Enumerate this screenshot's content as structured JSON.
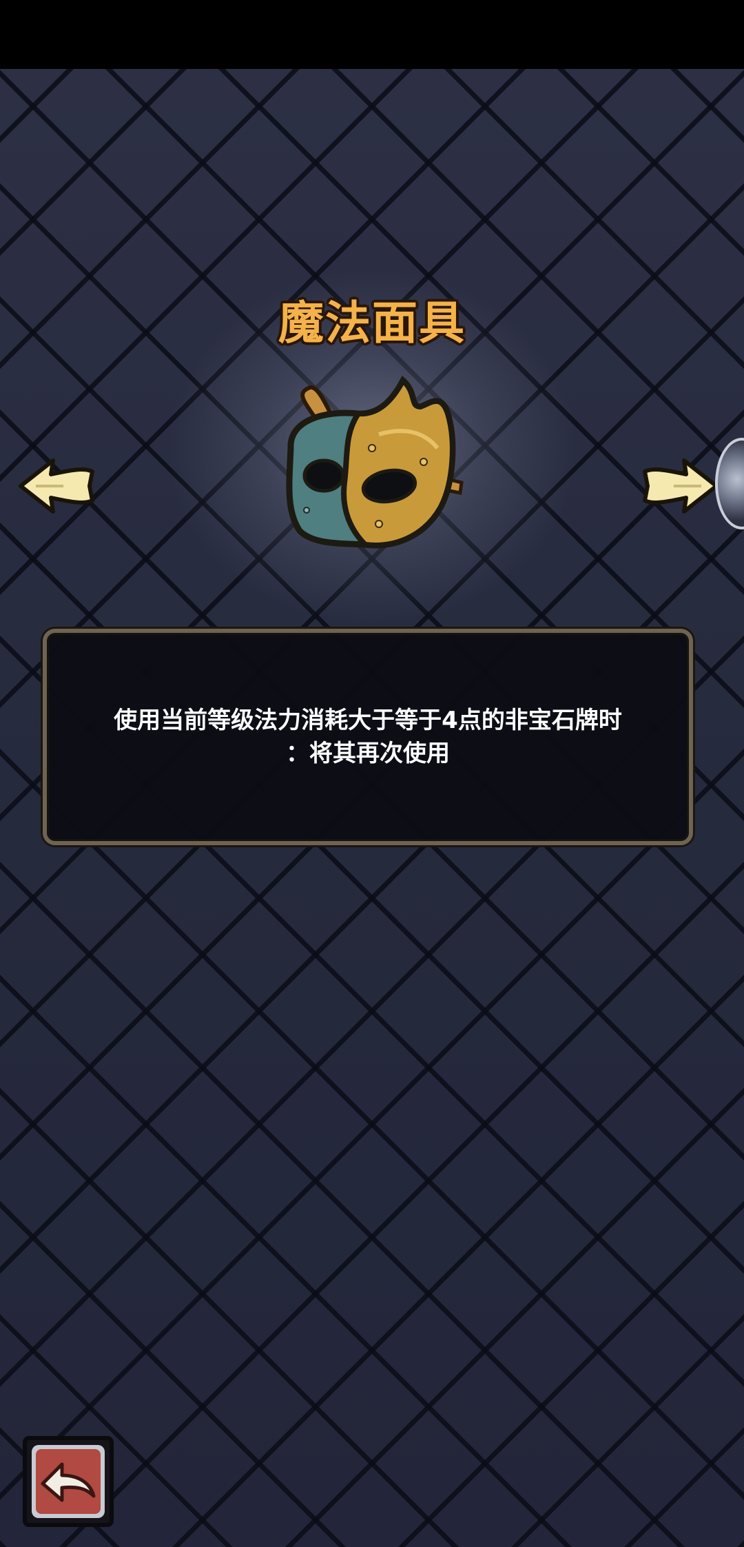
{
  "item": {
    "title": "魔法面具",
    "description_line1": "使用当前等级法力消耗大于等于4点的非宝石牌时",
    "description_line2": "：将其再次使用",
    "image_icon": "mask-icon"
  },
  "navigation": {
    "prev_icon": "arrow-left-icon",
    "next_icon": "arrow-right-icon",
    "back_icon": "back-arrow-icon"
  },
  "colors": {
    "title": "#f4b24a",
    "background": "#272a3e",
    "panel_border": "#6f6351",
    "arrow_fill": "#f5e9b0"
  }
}
